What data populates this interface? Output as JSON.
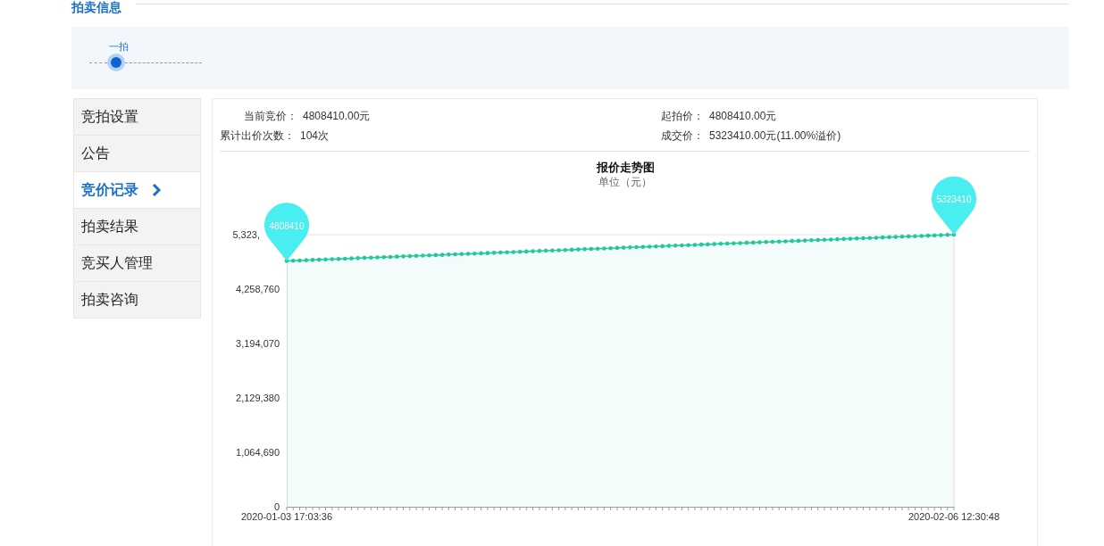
{
  "section_title": "拍卖信息",
  "steps": [
    {
      "label": "一拍",
      "selected": true
    }
  ],
  "sidebar": {
    "items": [
      {
        "label": "竞拍设置",
        "selected": false
      },
      {
        "label": "公告",
        "selected": false
      },
      {
        "label": "竞价记录",
        "selected": true
      },
      {
        "label": "拍卖结果",
        "selected": false
      },
      {
        "label": "竞买人管理",
        "selected": false
      },
      {
        "label": "拍卖咨询",
        "selected": false
      }
    ]
  },
  "summary": [
    {
      "label": "当前竞价：",
      "value": "4808410.00元"
    },
    {
      "label": "起拍价：",
      "value": "4808410.00元"
    },
    {
      "label": "累计出价次数：",
      "value": "104次"
    },
    {
      "label": "成交价：",
      "value": "5323410.00元(11.00%溢价)"
    }
  ],
  "chart": {
    "subtitle": "单位（元）",
    "y_top_label": "5,323,",
    "x_start_label": "2020-01-03 17:03:36",
    "x_end_label": "2020-02-06 12:30:48",
    "chart_data": {
      "type": "line",
      "title": "报价走势图",
      "series": [
        {
          "color": "#1ec99a",
          "values": [
            4808410,
            4813410,
            4818410,
            4823410,
            4828410,
            4833410,
            4838410,
            4843410,
            4848410,
            4853410,
            4858410,
            4863410,
            4868410,
            4873410,
            4878410,
            4883410,
            4888410,
            4893410,
            4898410,
            4903410,
            4908410,
            4913410,
            4918410,
            4923410,
            4928410,
            4933410,
            4938410,
            4943410,
            4948410,
            4953410,
            4958410,
            4963410,
            4968410,
            4973410,
            4978410,
            4983410,
            4988410,
            4993410,
            4998410,
            5003410,
            5008410,
            5013410,
            5018410,
            5023410,
            5028410,
            5033410,
            5038410,
            5043410,
            5048410,
            5053410,
            5058410,
            5063410,
            5068410,
            5073410,
            5078410,
            5083410,
            5088410,
            5093410,
            5098410,
            5103410,
            5108410,
            5113410,
            5118410,
            5123410,
            5128410,
            5133410,
            5138410,
            5143410,
            5148410,
            5153410,
            5158410,
            5163410,
            5168410,
            5173410,
            5178410,
            5183410,
            5188410,
            5193410,
            5198410,
            5203410,
            5208410,
            5213410,
            5218410,
            5223410,
            5228410,
            5233410,
            5238410,
            5243410,
            5248410,
            5253410,
            5258410,
            5263410,
            5268410,
            5273410,
            5278410,
            5283410,
            5288410,
            5293410,
            5298410,
            5303410,
            5308410,
            5313410,
            5318410,
            5323410
          ]
        }
      ],
      "ylim": [
        0,
        5323450
      ],
      "yticks": [
        0,
        {
          "value": 1064690,
          "label": "1,064,690"
        },
        {
          "value": 2129380,
          "label": "2,129,380"
        },
        {
          "value": 3194070,
          "label": "3,194,070"
        },
        {
          "value": 4258760,
          "label": "4,258,760"
        }
      ],
      "annotations": [
        "4808410",
        "5323410"
      ]
    }
  }
}
